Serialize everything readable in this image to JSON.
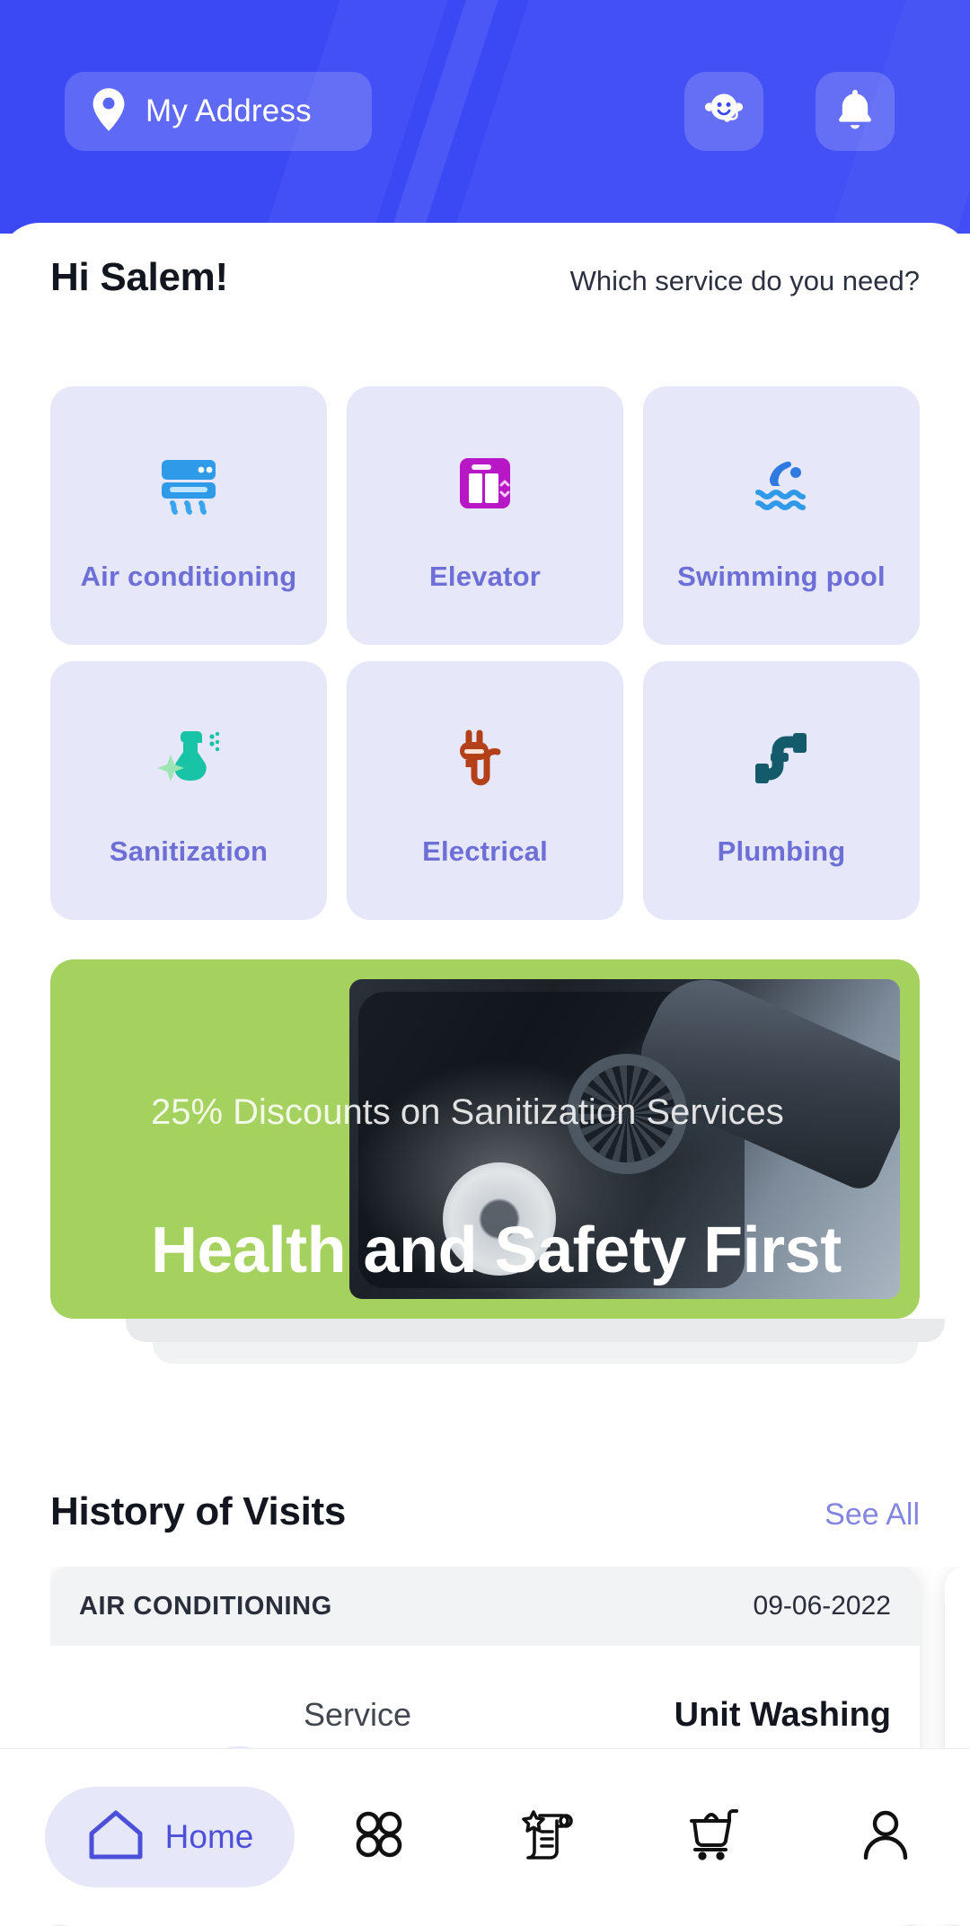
{
  "header": {
    "address_label": "My Address",
    "location_icon": "map-pin-icon",
    "support_icon": "customer-support-headset-icon",
    "bell_icon": "notification-bell-icon",
    "bg_color": "#3b49f5"
  },
  "greeting": {
    "hello": "Hi Salem!",
    "prompt": "Which service do you need?"
  },
  "services": [
    {
      "label": "Air conditioning",
      "icon": "air-conditioner-icon",
      "icon_color": "#2f9ae8"
    },
    {
      "label": "Elevator",
      "icon": "elevator-icon",
      "icon_color": "#b717c4"
    },
    {
      "label": "Swimming pool",
      "icon": "swimmer-waves-icon",
      "icon_color": "#2f79e0"
    },
    {
      "label": "Sanitization",
      "icon": "spray-bottle-icon",
      "icon_color": "#19c4a6"
    },
    {
      "label": "Electrical",
      "icon": "power-plug-icon",
      "icon_color": "#b4401a"
    },
    {
      "label": "Plumbing",
      "icon": "pipe-icon",
      "icon_color": "#135a6b"
    }
  ],
  "services_card_bg": "#e7e7fa",
  "services_label_color": "#6d6fd6",
  "promo": {
    "subtitle": "25% Discounts on Sanitization Services",
    "title": "Health and Safety First",
    "bg_color": "#a5d15e",
    "photo_alt": "steam-cleaning-brush-photo"
  },
  "history": {
    "title": "History of Visits",
    "see_all": "See All",
    "cards": [
      {
        "category": "AIR CONDITIONING",
        "date": "09-06-2022",
        "rows": [
          {
            "key": "Service",
            "value": "Unit Washing"
          }
        ]
      }
    ]
  },
  "bottom_nav": {
    "items": [
      {
        "label": "Home",
        "icon": "home-icon",
        "active": true
      },
      {
        "label": "",
        "icon": "grid-apps-icon",
        "active": false
      },
      {
        "label": "",
        "icon": "order-scroll-star-icon",
        "active": false
      },
      {
        "label": "",
        "icon": "shopping-cart-icon",
        "active": false
      },
      {
        "label": "",
        "icon": "profile-person-icon",
        "active": false
      }
    ],
    "active_color": "#4c4fd8",
    "active_pill_bg": "#e7e7fa"
  }
}
